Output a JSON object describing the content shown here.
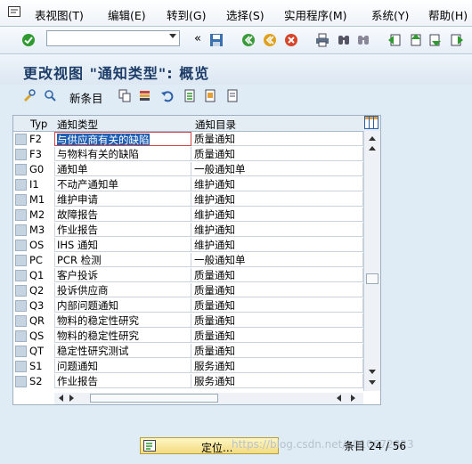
{
  "menu": {
    "items": [
      "表视图(T)",
      "编辑(E)",
      "转到(G)",
      "选择(S)",
      "实用程序(M)",
      "系统(Y)",
      "帮助(H)"
    ]
  },
  "toolbar": {
    "command_value": "",
    "icons": [
      "enter-check",
      "save",
      "back",
      "exit",
      "cancel",
      "print",
      "find",
      "find-next",
      "first-page",
      "previous-page",
      "next-page",
      "last-page"
    ]
  },
  "title": "更改视图 \"通知类型\": 概览",
  "app_toolbar": {
    "new_entries_label": "新条目"
  },
  "table": {
    "headers": [
      "Typ",
      "通知类型",
      "通知目录"
    ],
    "rows": [
      {
        "typ": "F2",
        "name": "与供应商有关的缺陷",
        "catalog": "质量通知"
      },
      {
        "typ": "F3",
        "name": "与物料有关的缺陷",
        "catalog": "质量通知"
      },
      {
        "typ": "G0",
        "name": "通知单",
        "catalog": "一般通知单"
      },
      {
        "typ": "I1",
        "name": "不动产通知单",
        "catalog": "维护通知"
      },
      {
        "typ": "M1",
        "name": "维护申请",
        "catalog": "维护通知"
      },
      {
        "typ": "M2",
        "name": "故障报告",
        "catalog": "维护通知"
      },
      {
        "typ": "M3",
        "name": "作业报告",
        "catalog": "维护通知"
      },
      {
        "typ": "OS",
        "name": "IHS 通知",
        "catalog": "维护通知"
      },
      {
        "typ": "PC",
        "name": "PCR 检测",
        "catalog": "一般通知单"
      },
      {
        "typ": "Q1",
        "name": "客户投诉",
        "catalog": "质量通知"
      },
      {
        "typ": "Q2",
        "name": "投诉供应商",
        "catalog": "质量通知"
      },
      {
        "typ": "Q3",
        "name": "内部问题通知",
        "catalog": "质量通知"
      },
      {
        "typ": "QR",
        "name": "物料的稳定性研究",
        "catalog": "质量通知"
      },
      {
        "typ": "QS",
        "name": "物料的稳定性研究",
        "catalog": "质量通知"
      },
      {
        "typ": "QT",
        "name": "稳定性研究测试",
        "catalog": "质量通知"
      },
      {
        "typ": "S1",
        "name": "问题通知",
        "catalog": "服务通知"
      },
      {
        "typ": "S2",
        "name": "作业报告",
        "catalog": "服务通知"
      }
    ]
  },
  "footer": {
    "position_button_label": "定位...",
    "entry_info": "条目 24 / 56",
    "watermark": "https://blog.csdn.net/u010672823"
  }
}
